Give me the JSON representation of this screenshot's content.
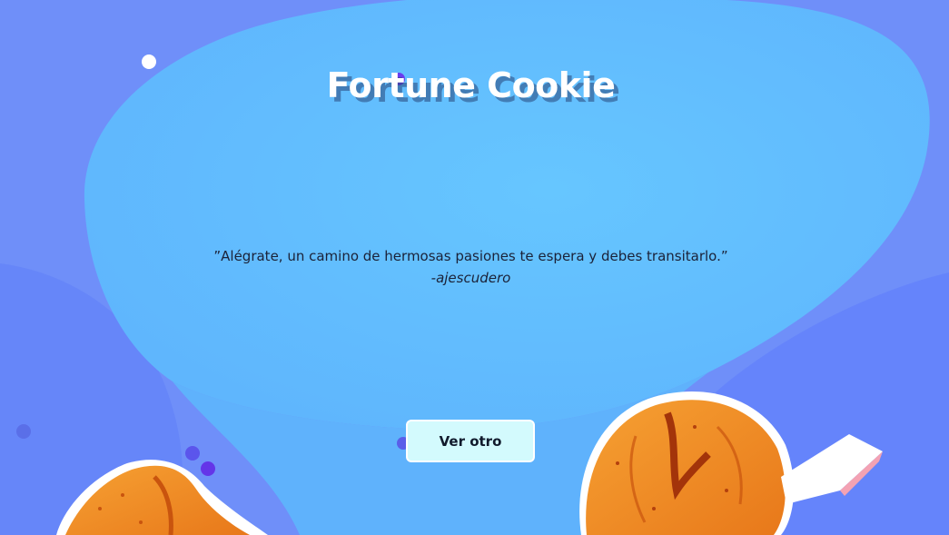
{
  "app": {
    "title": "Fortune Cookie"
  },
  "quote": {
    "text": "”Alégrate, un camino de hermosas pasiones te espera y debes transitarlo.”",
    "author": "-ajescudero"
  },
  "actions": {
    "next_label": "Ver otro"
  },
  "theme": {
    "background": "#6f8ff9",
    "blob": "#62c2fd",
    "button_bg": "#d3fafd",
    "cookie_orange": "#f08a1c",
    "cookie_dark": "#c9540e"
  },
  "icons": {
    "left_cookie": "fortune-cookie",
    "right_cookie": "fortune-cookie-with-paper"
  }
}
